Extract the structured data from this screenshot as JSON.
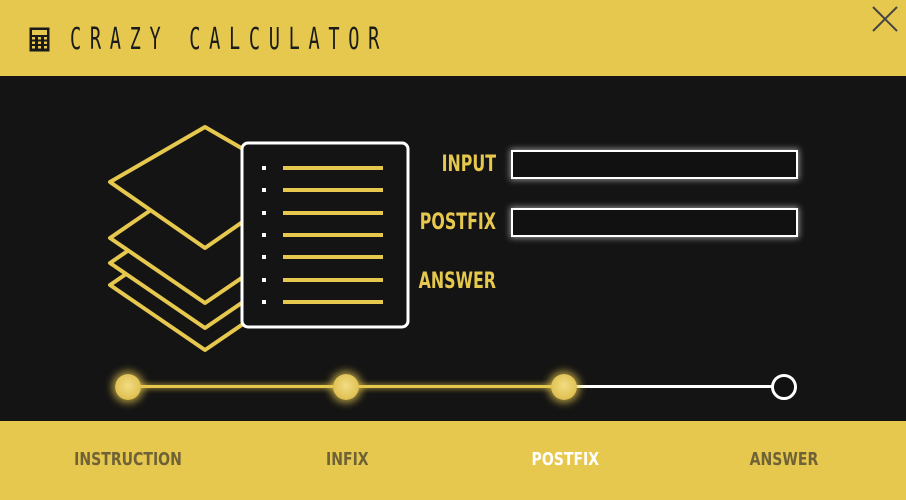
{
  "window": {
    "title": "CRAZY CALCULATOR",
    "icons": {
      "app": "calculator-icon",
      "close": "close-icon"
    }
  },
  "form": {
    "fields": [
      {
        "label": "INPUT",
        "value": ""
      },
      {
        "label": "POSTFIX",
        "value": ""
      },
      {
        "label": "ANSWER",
        "value": ""
      }
    ]
  },
  "stepper": {
    "completed_steps": 3,
    "total_steps": 4
  },
  "tabs": [
    {
      "label": "INSTRUCTION",
      "active": false
    },
    {
      "label": "INFIX",
      "active": false
    },
    {
      "label": "POSTFIX",
      "active": true
    },
    {
      "label": "ANSWER",
      "active": false
    }
  ],
  "colors": {
    "accent": "#e6c84e",
    "background": "#141414",
    "active_tab_text": "#ffffff",
    "inactive_tab_text": "#6e6236"
  }
}
